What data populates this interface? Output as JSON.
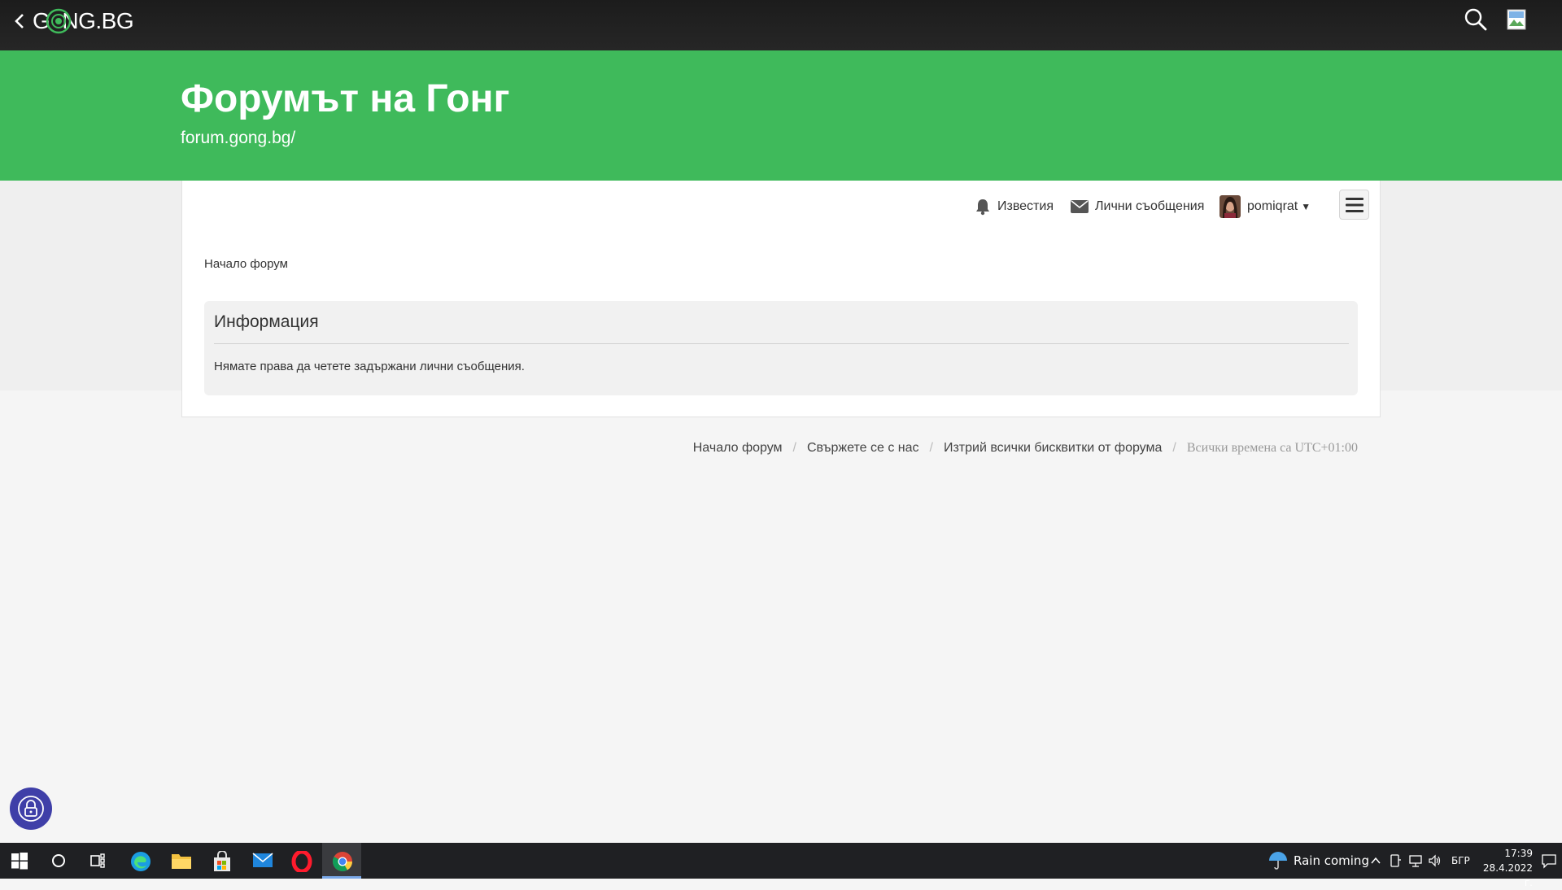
{
  "topbar": {
    "logo_prefix": "G",
    "logo_o": "o",
    "logo_suffix": "NG.BG"
  },
  "hero": {
    "title": "Форумът на Гонг",
    "url": "forum.gong.bg/"
  },
  "nav": {
    "notifications": "Известия",
    "messages": "Лични съобщения",
    "username": "pomiqrat"
  },
  "breadcrumb": "Начало форум",
  "info": {
    "title": "Информация",
    "message": "Нямате права да четете задържани лични съобщения."
  },
  "footer": {
    "links": [
      "Начало форум",
      "Свържете се с нас",
      "Изтрий всички бисквитки от форума"
    ],
    "timezone": "Всички времена са UTC+01:00"
  },
  "taskbar": {
    "weather": "Rain coming",
    "language": "БГР",
    "time": "17:39",
    "date": "28.4.2022 г."
  },
  "colors": {
    "brand_green": "#3fba5b",
    "topbar": "#1f1f1f",
    "lock_button": "#3f3fa8"
  }
}
